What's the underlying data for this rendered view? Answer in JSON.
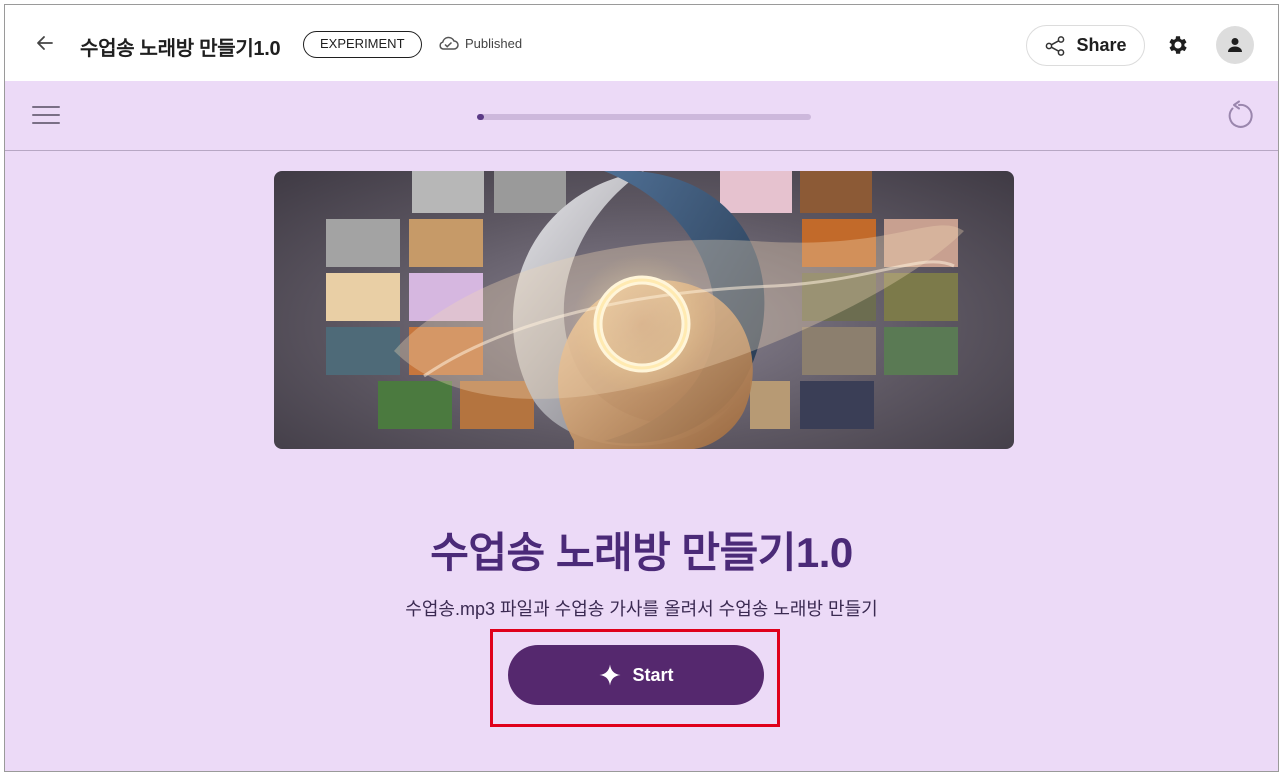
{
  "header": {
    "title": "수업송 노래방 만들기1.0",
    "badge": "EXPERIMENT",
    "status": "Published",
    "share_label": "Share",
    "icons": [
      "back-arrow-icon",
      "cloud-icon",
      "share-icon",
      "gear-icon",
      "account-icon"
    ]
  },
  "toolbar": {
    "icons": [
      "hamburger-menu-icon",
      "restart-icon"
    ],
    "progress": 0.02
  },
  "hero_image": {
    "description_icon": "collage-of-media-thumbnails-around-swirling-ring"
  },
  "main": {
    "title": "수업송 노래방 만들기1.0",
    "description": "수업송.mp3 파일과 수업송 가사를 올려서 수업송 노래방 만들기",
    "start_label": "Start"
  },
  "colors": {
    "canvas_bg": "#ecdaf7",
    "title_color": "#4b2a78",
    "button_bg": "#55286e",
    "highlight_border": "#e0001b"
  }
}
